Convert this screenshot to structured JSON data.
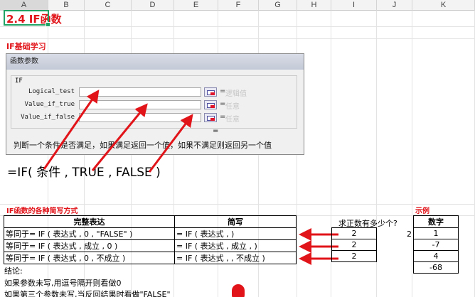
{
  "columns": [
    "A",
    "B",
    "C",
    "D",
    "E",
    "F",
    "G",
    "H",
    "I",
    "J",
    "K"
  ],
  "title": "2.4 IF函数",
  "section1": "IF基础学习",
  "dialog": {
    "title": "函数参数",
    "func": "IF",
    "args": [
      {
        "label": "Logical_test",
        "result": "逻辑值"
      },
      {
        "label": "Value_if_true",
        "result": "任意"
      },
      {
        "label": "Value_if_false",
        "result": "任意"
      }
    ],
    "eq": "=",
    "description": "判断一个条件是否满足，如果满足返回一个值，如果不满足则返回另一个值"
  },
  "formula": "=IF( 条件 , TRUE , FALSE )",
  "section2": "IF函数的各种简写方式",
  "section3": "示例",
  "table": {
    "headers": [
      "完整表达",
      "简写"
    ],
    "rows": [
      [
        "等同于= IF ( 表达式 , 0 , \"FALSE\" )",
        "= IF ( 表达式 , )"
      ],
      [
        "等同于= IF ( 表达式 , 成立 , 0 )",
        "= IF ( 表达式 , 成立 , )"
      ],
      [
        "等同于= IF ( 表达式 , 0 , 不成立 )",
        "= IF ( 表达式 , , 不成立 )"
      ]
    ]
  },
  "question": "求正数有多少个?",
  "results": [
    "2",
    "2",
    "2"
  ],
  "j_value": "2",
  "numbers_header": "数字",
  "numbers": [
    "1",
    "-7",
    "4",
    "-68"
  ],
  "conclusion": "结论:",
  "note1": "如果参数未写,用逗号隔开则看做0",
  "note2": "如果第三个参数未写,当反回结果时看做\"FALSE\""
}
